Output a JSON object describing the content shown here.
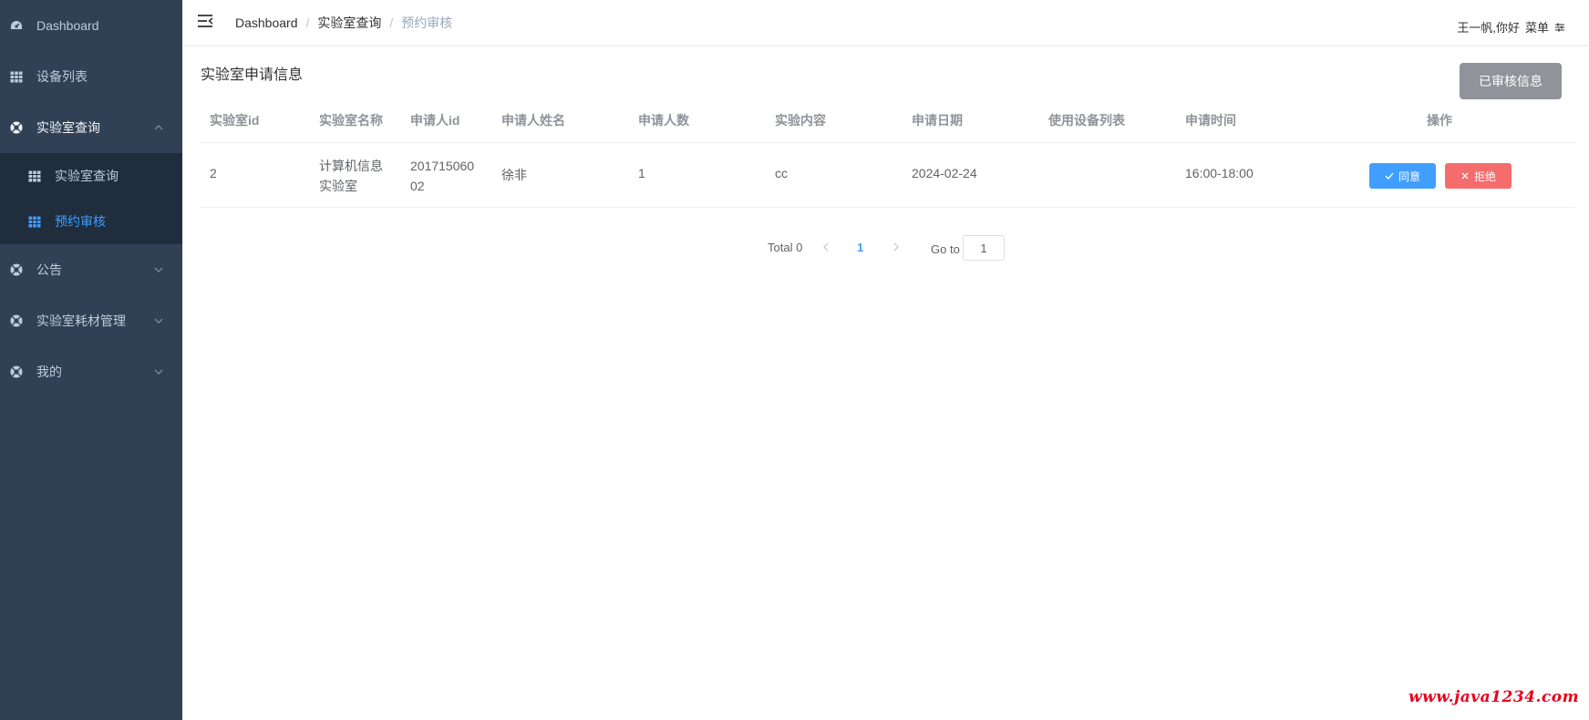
{
  "colors": {
    "sidebar_bg": "#304156",
    "submenu_bg": "#1f2d3d",
    "active": "#409eff",
    "agree": "#409eff",
    "reject": "#f56c6c",
    "reviewed_button": "#909399",
    "watermark": "#e8001c"
  },
  "sidebar": {
    "items": [
      {
        "label": "Dashboard",
        "icon": "dashboard-icon"
      },
      {
        "label": "设备列表",
        "icon": "table-icon"
      },
      {
        "label": "实验室查询",
        "icon": "lifebuoy-icon",
        "expanded": true,
        "children": [
          {
            "label": "实验室查询",
            "icon": "table-icon"
          },
          {
            "label": "预约审核",
            "icon": "table-icon",
            "active": true
          }
        ]
      },
      {
        "label": "公告",
        "icon": "lifebuoy-icon"
      },
      {
        "label": "实验室耗材管理",
        "icon": "lifebuoy-icon"
      },
      {
        "label": "我的",
        "icon": "lifebuoy-icon"
      }
    ]
  },
  "header": {
    "breadcrumb": [
      "Dashboard",
      "实验室查询",
      "预约审核"
    ],
    "user_greeting": "王一帆,你好",
    "menu_label": "菜单"
  },
  "main": {
    "title": "实验室申请信息",
    "reviewed_button": "已审核信息",
    "table": {
      "columns": [
        "实验室id",
        "实验室名称",
        "申请人id",
        "申请人姓名",
        "申请人数",
        "实验内容",
        "申请日期",
        "使用设备列表",
        "申请时间",
        "操作"
      ],
      "rows": [
        {
          "lab_id": "2",
          "lab_name_line1": "计算机信息",
          "lab_name_line2": "实验室",
          "applicant_id_line1": "201715060",
          "applicant_id_line2": "02",
          "applicant_name": "徐非",
          "people": "1",
          "content": "cc",
          "date": "2024-02-24",
          "equipment": "",
          "time": "16:00-18:00",
          "agree_label": "同意",
          "reject_label": "拒绝"
        }
      ]
    },
    "pagination": {
      "total_text": "Total 0",
      "current_page": "1",
      "goto_label": "Go to",
      "goto_value": "1"
    }
  },
  "watermark": "www.java1234.com"
}
